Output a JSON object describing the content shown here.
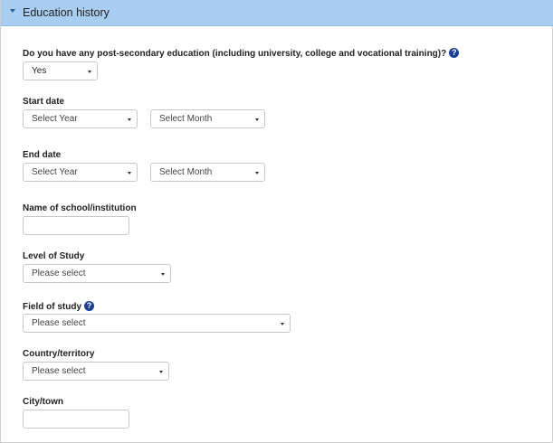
{
  "panel": {
    "title": "Education history"
  },
  "form": {
    "post_secondary": {
      "label": "Do you have any post-secondary education (including university, college and vocational training)?",
      "value": "Yes"
    },
    "start_date": {
      "label": "Start date",
      "year_value": "Select Year",
      "month_value": "Select Month"
    },
    "end_date": {
      "label": "End date",
      "year_value": "Select Year",
      "month_value": "Select Month"
    },
    "school": {
      "label": "Name of school/institution",
      "value": ""
    },
    "level": {
      "label": "Level of Study",
      "value": "Please select"
    },
    "field": {
      "label": "Field of study",
      "value": "Please select"
    },
    "country": {
      "label": "Country/territory",
      "value": "Please select"
    },
    "city": {
      "label": "City/town",
      "value": ""
    }
  },
  "icons": {
    "help": "?"
  }
}
